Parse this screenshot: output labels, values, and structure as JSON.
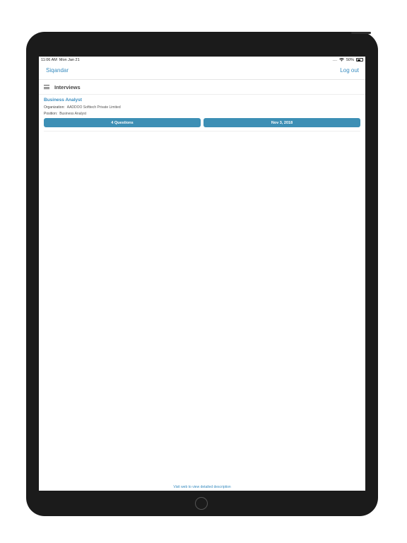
{
  "status_bar": {
    "time": "11:06 AM",
    "date": "Mon Jan 21",
    "signal": "....",
    "battery_percent": "50%",
    "battery_level": 0.5
  },
  "nav": {
    "left_label": "Siqandar",
    "right_label": "Log out"
  },
  "section": {
    "title": "Interviews"
  },
  "interview": {
    "title": "Business Analyst",
    "organization_label": "Organization:",
    "organization_value": "AADDOO Softtech Private Limited",
    "position_label": "Position:",
    "position_value": "Business Analyst",
    "questions_button": "4 Questions",
    "date_button": "Nov 3, 2018"
  },
  "footer": {
    "link_text": "Visit web to view detailed description"
  },
  "colors": {
    "accent": "#3a8dc0",
    "button": "#3d8fb5",
    "device": "#1b1b1b"
  }
}
